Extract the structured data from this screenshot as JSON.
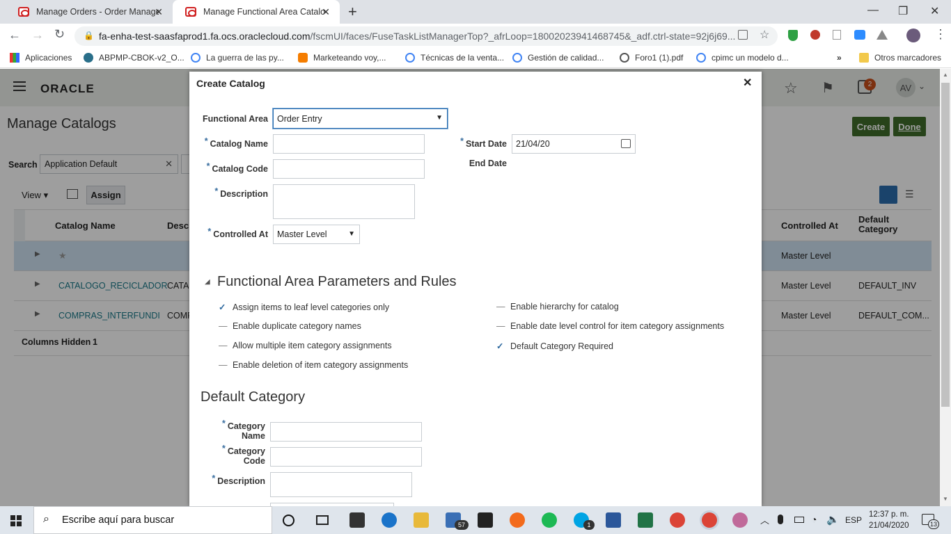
{
  "browser": {
    "tabs": [
      {
        "title": "Manage Orders - Order Managem",
        "active": false
      },
      {
        "title": "Manage Functional Area Catalog",
        "active": true
      }
    ],
    "url_host": "fa-enha-test-saasfaprod1.fa.ocs.oraclecloud.com",
    "url_path": "/fscmUI/faces/FuseTaskListManagerTop?_afrLoop=18002023941468745&_adf.ctrl-state=92j6j69...",
    "extension_badge": "57",
    "bookmarks": [
      "Aplicaciones",
      "ABPMP-CBOK-v2_O...",
      "La guerra de las py...",
      "Marketeando voy,...",
      "Técnicas de la venta...",
      "Gestión de calidad...",
      "Foro1 (1).pdf",
      "cpimc un modelo d..."
    ],
    "other_bookmarks": "Otros marcadores"
  },
  "app": {
    "logo": "ORACLE",
    "notification_count": "2",
    "user_initials": "AV",
    "page_title": "Manage Catalogs",
    "search_label": "Search",
    "search_value": "Application Default",
    "view_label": "View",
    "assign_label": "Assign",
    "create_label": "Create",
    "done_label": "Done",
    "columns": {
      "name": "Catalog Name",
      "desc": "Desc",
      "controlled": "Controlled At",
      "default": "Default Category"
    },
    "rows": [
      {
        "name": "",
        "desc": "",
        "controlled": "Master Level",
        "default": ""
      },
      {
        "name": "CATALOGO_RECICLADOR",
        "desc": "CATA",
        "controlled": "Master Level",
        "default": "DEFAULT_INV"
      },
      {
        "name": "COMPRAS_INTERFUNDI",
        "desc": "COMP",
        "controlled": "Master Level",
        "default": "DEFAULT_COM..."
      }
    ],
    "columns_hidden_label": "Columns Hidden",
    "columns_hidden_count": "1"
  },
  "dialog": {
    "title": "Create Catalog",
    "functional_area_label": "Functional Area",
    "functional_area_value": "Order Entry",
    "catalog_name_label": "Catalog Name",
    "catalog_code_label": "Catalog Code",
    "description_label": "Description",
    "controlled_at_label": "Controlled At",
    "controlled_at_value": "Master Level",
    "start_date_label": "Start Date",
    "start_date_value": "21/04/20",
    "end_date_label": "End Date",
    "params_heading": "Functional Area Parameters and Rules",
    "params": [
      {
        "label": "Assign items to leaf level categories only",
        "checked": true
      },
      {
        "label": "Enable duplicate category names",
        "checked": false
      },
      {
        "label": "Allow multiple item category assignments",
        "checked": false
      },
      {
        "label": "Enable deletion of item category assignments",
        "checked": false
      },
      {
        "label": "Enable hierarchy for catalog",
        "checked": false
      },
      {
        "label": "Enable date level control for item category assignments",
        "checked": false
      },
      {
        "label": "Default Category Required",
        "checked": true
      }
    ],
    "default_heading": "Default Category",
    "category_name_label_1": "Category",
    "category_name_label_2": "Name",
    "category_code_label_1": "Category",
    "category_code_label_2": "Code",
    "cat_description_label": "Description",
    "required_mark": "*"
  },
  "taskbar": {
    "search_placeholder": "Escribe aquí para buscar",
    "lang": "ESP",
    "time": "12:37 p. m.",
    "date": "21/04/2020",
    "notif_count": "13",
    "mail_badge": "57",
    "skype_badge": "1"
  },
  "colors": {
    "accent_green": "#3f6d2a",
    "link": "#1a7a8a",
    "selected_row": "#cfe2f3"
  }
}
